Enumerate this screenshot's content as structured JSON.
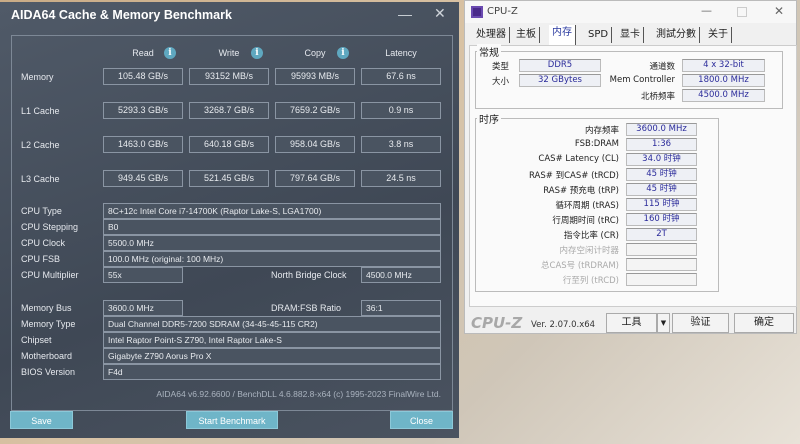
{
  "aida": {
    "title": "AIDA64 Cache & Memory Benchmark",
    "headers": {
      "read": "Read",
      "write": "Write",
      "copy": "Copy",
      "latency": "Latency"
    },
    "rows": [
      {
        "label": "Memory",
        "read": "105.48 GB/s",
        "write": "93152 MB/s",
        "copy": "95993 MB/s",
        "latency": "67.6 ns"
      },
      {
        "label": "L1 Cache",
        "read": "5293.3 GB/s",
        "write": "3268.7 GB/s",
        "copy": "7659.2 GB/s",
        "latency": "0.9 ns"
      },
      {
        "label": "L2 Cache",
        "read": "1463.0 GB/s",
        "write": "640.18 GB/s",
        "copy": "958.04 GB/s",
        "latency": "3.8 ns"
      },
      {
        "label": "L3 Cache",
        "read": "949.45 GB/s",
        "write": "521.45 GB/s",
        "copy": "797.64 GB/s",
        "latency": "24.5 ns"
      }
    ],
    "cpu_type": {
      "label": "CPU Type",
      "value": "8C+12c Intel Core i7-14700K  (Raptor Lake-S, LGA1700)"
    },
    "cpu_stepping": {
      "label": "CPU Stepping",
      "value": "B0"
    },
    "cpu_clock": {
      "label": "CPU Clock",
      "value": "5500.0 MHz"
    },
    "cpu_fsb": {
      "label": "CPU FSB",
      "value": "100.0 MHz  (original: 100 MHz)"
    },
    "cpu_multiplier": {
      "label": "CPU Multiplier",
      "value": "55x"
    },
    "nb_clock": {
      "label": "North Bridge Clock",
      "value": "4500.0 MHz"
    },
    "memory_bus": {
      "label": "Memory Bus",
      "value": "3600.0 MHz"
    },
    "dram_fsb": {
      "label": "DRAM:FSB Ratio",
      "value": "36:1"
    },
    "memory_type": {
      "label": "Memory Type",
      "value": "Dual Channel DDR5-7200 SDRAM  (34-45-45-115 CR2)"
    },
    "chipset": {
      "label": "Chipset",
      "value": "Intel Raptor Point-S Z790, Intel Raptor Lake-S"
    },
    "motherboard": {
      "label": "Motherboard",
      "value": "Gigabyte Z790 Aorus Pro X"
    },
    "bios": {
      "label": "BIOS Version",
      "value": "F4d"
    },
    "footer": "AIDA64 v6.92.6600 / BenchDLL 4.6.882.8-x64  (c) 1995-2023 FinalWire Ltd.",
    "buttons": {
      "save": "Save",
      "start": "Start Benchmark",
      "close": "Close"
    }
  },
  "cpuz": {
    "title": "CPU-Z",
    "tabs": [
      "处理器",
      "主板",
      "内存",
      "SPD",
      "显卡",
      "測試分數",
      "关于"
    ],
    "general_title": "常规",
    "type_label": "类型",
    "type_value": "DDR5",
    "size_label": "大小",
    "size_value": "32 GBytes",
    "channels_label": "通道数",
    "channels_value": "4 x 32-bit",
    "memctrl_label": "Mem Controller",
    "memctrl_value": "1800.0 MHz",
    "nb_label": "北桥频率",
    "nb_value": "4500.0 MHz",
    "timings_title": "时序",
    "timings": [
      {
        "label": "内存频率",
        "value": "3600.0 MHz"
      },
      {
        "label": "FSB:DRAM",
        "value": "1:36"
      },
      {
        "label": "CAS# Latency (CL)",
        "value": "34.0 时钟"
      },
      {
        "label": "RAS# 到CAS# (tRCD)",
        "value": "45 时钟"
      },
      {
        "label": "RAS# 预充电 (tRP)",
        "value": "45 时钟"
      },
      {
        "label": "循环周期 (tRAS)",
        "value": "115 时钟"
      },
      {
        "label": "行周期时间 (tRC)",
        "value": "160 时钟"
      },
      {
        "label": "指令比率 (CR)",
        "value": "2T"
      },
      {
        "label": "内存空闲计时器",
        "value": ""
      },
      {
        "label": "总CAS号 (tRDRAM)",
        "value": ""
      },
      {
        "label": "行至列 (tRCD)",
        "value": ""
      }
    ],
    "logo": "CPU-Z",
    "version": "Ver. 2.07.0.x64",
    "tools": "工具",
    "validate": "验证",
    "ok": "确定"
  }
}
